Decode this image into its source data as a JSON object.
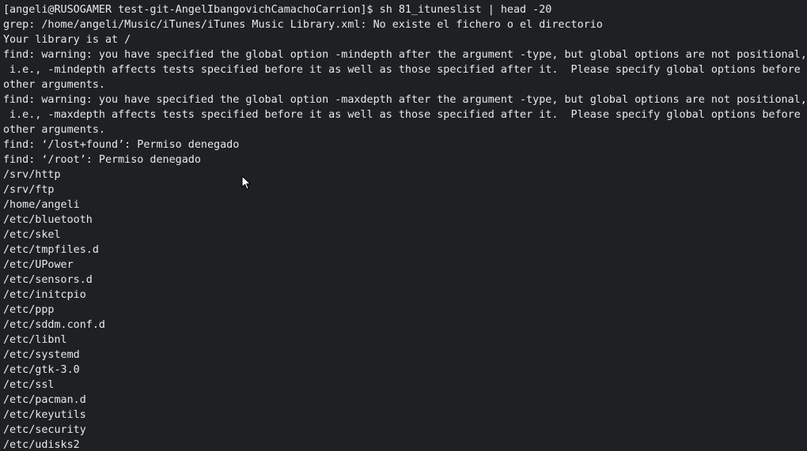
{
  "terminal": {
    "lines": [
      "[angeli@RUSOGAMER test-git-AngelIbangovichCamachoCarrion]$ sh 81_ituneslist | head -20",
      "grep: /home/angeli/Music/iTunes/iTunes Music Library.xml: No existe el fichero o el directorio",
      "Your library is at /",
      "find: warning: you have specified the global option -mindepth after the argument -type, but global options are not positional,",
      " i.e., -mindepth affects tests specified before it as well as those specified after it.  Please specify global options before",
      "other arguments.",
      "find: warning: you have specified the global option -maxdepth after the argument -type, but global options are not positional,",
      " i.e., -maxdepth affects tests specified before it as well as those specified after it.  Please specify global options before",
      "other arguments.",
      "find: ‘/lost+found’: Permiso denegado",
      "find: ‘/root’: Permiso denegado",
      "/srv/http",
      "/srv/ftp",
      "/home/angeli",
      "/etc/bluetooth",
      "/etc/skel",
      "/etc/tmpfiles.d",
      "/etc/UPower",
      "/etc/sensors.d",
      "/etc/initcpio",
      "/etc/ppp",
      "/etc/sddm.conf.d",
      "/etc/libnl",
      "/etc/systemd",
      "/etc/gtk-3.0",
      "/etc/ssl",
      "/etc/pacman.d",
      "/etc/keyutils",
      "/etc/security",
      "/etc/udisks2"
    ]
  },
  "pointer": {
    "icon": "mouse-pointer-icon"
  },
  "colors": {
    "background": "#1e2023",
    "foreground": "#eaeaea"
  }
}
